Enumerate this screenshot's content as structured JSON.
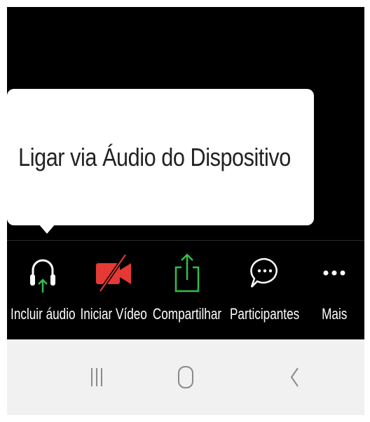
{
  "tooltip": {
    "text": "Ligar via Áudio do Dispositivo"
  },
  "toolbar": {
    "items": [
      {
        "label": "Incluir áudio",
        "icon": "headphones-icon"
      },
      {
        "label": "Iniciar Vídeo",
        "icon": "video-off-icon"
      },
      {
        "label": "Compartilhar",
        "icon": "share-icon"
      },
      {
        "label": "Participantes",
        "icon": "chat-bubble-icon"
      },
      {
        "label": "Mais",
        "icon": "more-dots-icon"
      }
    ]
  },
  "navbar": {
    "items": [
      {
        "icon": "recent-apps-icon"
      },
      {
        "icon": "home-icon"
      },
      {
        "icon": "back-icon"
      }
    ]
  },
  "colors": {
    "background": "#000000",
    "accent_green": "#2fbf4a",
    "video_red": "#e53935",
    "navbar": "#f1f1f1"
  }
}
